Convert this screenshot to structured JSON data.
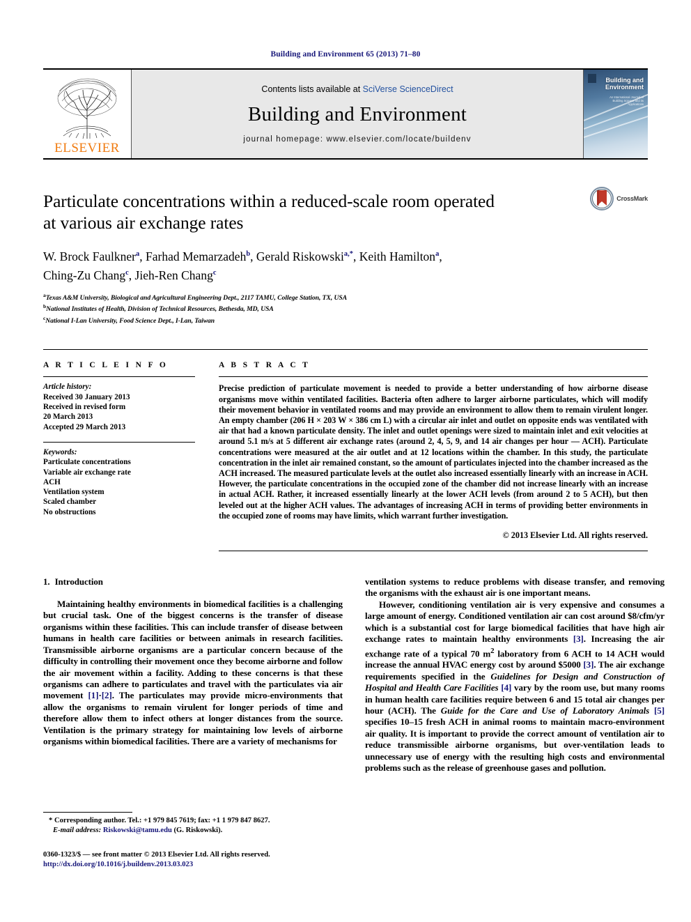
{
  "running_head": "Building and Environment 65 (2013) 71–80",
  "masthead": {
    "publisher_name": "ELSEVIER",
    "contents_prefix": "Contents lists available at ",
    "contents_link": "SciVerse ScienceDirect",
    "journal_name": "Building and Environment",
    "homepage": "journal homepage: www.elsevier.com/locate/buildenv",
    "cover": {
      "title_line1": "Building and",
      "title_line2": "Environment",
      "subtitle": "An International Journal of Building Science and its Applications"
    }
  },
  "article": {
    "title_line1": "Particulate concentrations within a reduced-scale room operated",
    "title_line2": "at various air exchange rates",
    "crossmark_label": "CrossMark",
    "authors_line1": "W. Brock Faulkner",
    "authors": [
      {
        "name": "W. Brock Faulkner",
        "sup": "a"
      },
      {
        "name": "Farhad Memarzadeh",
        "sup": "b"
      },
      {
        "name": "Gerald Riskowski",
        "sup": "a,*"
      },
      {
        "name": "Keith Hamilton",
        "sup": "a"
      },
      {
        "name": "Ching-Zu Chang",
        "sup": "c"
      },
      {
        "name": "Jieh-Ren Chang",
        "sup": "c"
      }
    ],
    "affiliations": [
      {
        "mark": "a",
        "text": "Texas A&M University, Biological and Agricultural Engineering Dept., 2117 TAMU, College Station, TX, USA"
      },
      {
        "mark": "b",
        "text": "National Institutes of Health, Division of Technical Resources, Bethesda, MD, USA"
      },
      {
        "mark": "c",
        "text": "National I-Lan University, Food Science Dept., I-Lan, Taiwan"
      }
    ]
  },
  "article_info": {
    "heading": "A R T I C L E   I N F O",
    "history_label": "Article history:",
    "history": [
      "Received 30 January 2013",
      "Received in revised form",
      "20 March 2013",
      "Accepted 29 March 2013"
    ],
    "keywords_label": "Keywords:",
    "keywords": [
      "Particulate concentrations",
      "Variable air exchange rate",
      "ACH",
      "Ventilation system",
      "Scaled chamber",
      "No obstructions"
    ]
  },
  "abstract": {
    "heading": "A B S T R A C T",
    "text": "Precise prediction of particulate movement is needed to provide a better understanding of how airborne disease organisms move within ventilated facilities. Bacteria often adhere to larger airborne particulates, which will modify their movement behavior in ventilated rooms and may provide an environment to allow them to remain virulent longer. An empty chamber (206 H × 203 W × 386 cm L) with a circular air inlet and outlet on opposite ends was ventilated with air that had a known particulate density. The inlet and outlet openings were sized to maintain inlet and exit velocities at around 5.1 m/s at 5 different air exchange rates (around 2, 4, 5, 9, and 14 air changes per hour — ACH). Particulate concentrations were measured at the air outlet and at 12 locations within the chamber. In this study, the particulate concentration in the inlet air remained constant, so the amount of particulates injected into the chamber increased as the ACH increased. The measured particulate levels at the outlet also increased essentially linearly with an increase in ACH. However, the particulate concentrations in the occupied zone of the chamber did not increase linearly with an increase in actual ACH. Rather, it increased essentially linearly at the lower ACH levels (from around 2 to 5 ACH), but then leveled out at the higher ACH values. The advantages of increasing ACH in terms of providing better environments in the occupied zone of rooms may have limits, which warrant further investigation.",
    "copyright": "© 2013 Elsevier Ltd. All rights reserved."
  },
  "introduction": {
    "number": "1.",
    "title": "Introduction",
    "left_paragraph_part1": "Maintaining healthy environments in biomedical facilities is a challenging but crucial task. One of the biggest concerns is the transfer of disease organisms within these facilities. This can include transfer of disease between humans in health care facilities or between animals in research facilities. Transmissible airborne organisms are a particular concern because of the difficulty in controlling their movement once they become airborne and follow the air movement within a facility. Adding to these concerns is that these organisms can adhere to particulates and travel with the particulates via air movement ",
    "ref_1": "[1]",
    "ref_1_sep": "·",
    "ref_2": "[2]",
    "left_paragraph_part2": ". The particulates may provide micro-environments that allow the organisms to remain virulent for longer periods of time and therefore allow them to infect others at longer distances from the source. Ventilation is the primary strategy for maintaining low levels of airborne organisms within biomedical facilities. There are a variety of mechanisms for",
    "right_paragraph_1_cont": "ventilation systems to reduce problems with disease transfer, and removing the organisms with the exhaust air is one important means.",
    "right_paragraph_2_part1": "However, conditioning ventilation air is very expensive and consumes a large amount of energy. Conditioned ventilation air can cost around $8/cfm/yr which is a substantial cost for large biomedical facilities that have high air exchange rates to maintain healthy environments ",
    "ref_3a": "[3]",
    "right_paragraph_2_part2": ". Increasing the air exchange rate of a typical 70 m",
    "sup_2": "2",
    "right_paragraph_2_part3": " laboratory from 6 ACH to 14 ACH would increase the annual HVAC energy cost by around $5000 ",
    "ref_3b": "[3]",
    "right_paragraph_2_part4": ". The air exchange requirements specified in the ",
    "guideline_1": "Guidelines for Design and Construction of Hospital and Health Care Facilities",
    "ref_4": "[4]",
    "right_paragraph_2_part5": " vary by the room use, but many rooms in human health care facilities require between 6 and 15 total air changes per hour (ACH). The ",
    "guideline_2": "Guide for the Care and Use of Laboratory Animals",
    "ref_5": "[5]",
    "right_paragraph_2_part6": " specifies 10–15 fresh ACH in animal rooms to maintain macro-environment air quality. It is important to provide the correct amount of ventilation air to reduce transmissible airborne organisms, but over-ventilation leads to unnecessary use of energy with the resulting high costs and environmental problems such as the release of greenhouse gases and pollution."
  },
  "footnotes": {
    "corresponding_star": "*",
    "corresponding_text": "Corresponding author. Tel.: +1 979 845 7619; fax: +1 1 979 847 8627.",
    "email_label": "E-mail address:",
    "email": "Riskowski@tamu.edu",
    "email_suffix": "(G. Riskowski).",
    "imprint_line": "0360-1323/$ — see front matter © 2013 Elsevier Ltd. All rights reserved.",
    "doi": "http://dx.doi.org/10.1016/j.buildenv.2013.03.023"
  },
  "colors": {
    "link_blue": "#18187a",
    "sciencedirect_blue": "#2452a0",
    "elsevier_orange": "#f07c12"
  }
}
